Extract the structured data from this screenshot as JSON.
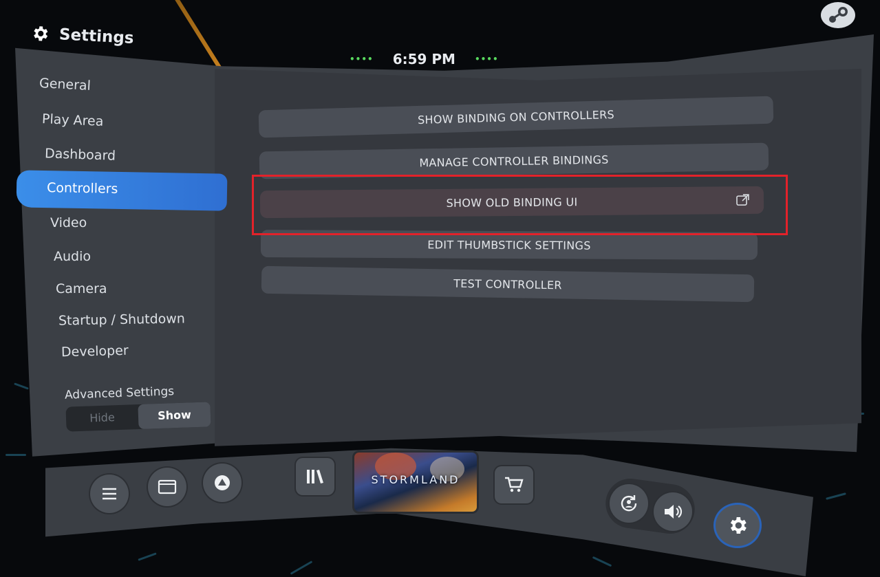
{
  "header": {
    "title": "Settings",
    "time": "6:59 PM",
    "indicator_left": "••••",
    "indicator_right": "••••"
  },
  "sidebar": {
    "items": [
      {
        "label": "General"
      },
      {
        "label": "Play Area"
      },
      {
        "label": "Dashboard"
      },
      {
        "label": "Controllers"
      },
      {
        "label": "Video"
      },
      {
        "label": "Audio"
      },
      {
        "label": "Camera"
      },
      {
        "label": "Startup / Shutdown"
      },
      {
        "label": "Developer"
      }
    ],
    "active_item": "Controllers",
    "advanced": {
      "label": "Advanced Settings",
      "hide": "Hide",
      "show": "Show",
      "selected": "Show"
    }
  },
  "main": {
    "buttons": [
      {
        "label": "SHOW BINDING ON CONTROLLERS"
      },
      {
        "label": "MANAGE CONTROLLER BINDINGS"
      },
      {
        "label": "SHOW OLD BINDING UI",
        "icon": "external-link-icon",
        "highlighted": true
      },
      {
        "label": "EDIT THUMBSTICK SETTINGS"
      },
      {
        "label": "TEST CONTROLLER"
      }
    ]
  },
  "taskbar": {
    "game_title": "STORMLAND",
    "icons": [
      "menu-icon",
      "window-icon",
      "steamvr-home-icon",
      "library-icon",
      "store-cart-icon",
      "recenter-icon",
      "volume-icon",
      "gear-icon"
    ]
  },
  "colors": {
    "accent": "#3b8ee9",
    "highlight_box": "#e3222a",
    "status_dots": "#59d95f",
    "panel": "#3b3f45"
  }
}
